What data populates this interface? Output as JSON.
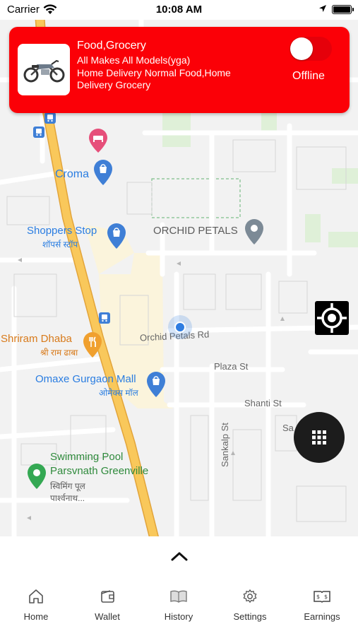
{
  "status_bar": {
    "carrier": "Carrier",
    "time": "10:08 AM"
  },
  "card": {
    "title": "Food,Grocery",
    "line1": "All Makes All Models(yga)",
    "line2": "Home Delivery Normal Food,Home",
    "line3": "Delivery Grocery",
    "status": "Offline",
    "toggle_on": false,
    "thumbnail_icon": "motorcycle-image"
  },
  "map": {
    "labels": {
      "croma": "Croma",
      "shoppers_stop": "Shoppers Stop",
      "shoppers_stop_hi": "शॉपर्स स्टॉप",
      "orchid_petals": "ORCHID PETALS",
      "orchid_petals_rd": "Orchid Petals Rd",
      "shriram_dhaba": "Shriram Dhaba",
      "shriram_dhaba_hi": "श्री राम ढाबा",
      "omaxe_mall": "Omaxe Gurgaon Mall",
      "omaxe_mall_hi": "ओमेक्स मॉल",
      "plaza_st": "Plaza St",
      "shanti_st": "Shanti St",
      "sankalp_st": "Sankalp St",
      "swimming_pool_1": "Swimming Pool",
      "swimming_pool_2": "Parsvnath Greenville",
      "swimming_pool_hi1": "स्विमिंग पूल",
      "swimming_pool_hi2": "पार्श्वनाथ..."
    },
    "colors": {
      "highway": "#f9c85b",
      "highway_edge": "#e7a83c",
      "mall_area": "#fbf4dc",
      "road": "#ffffff",
      "user_dot": "#2f7de1"
    }
  },
  "tabs": [
    {
      "label": "Home",
      "icon": "home-icon"
    },
    {
      "label": "Wallet",
      "icon": "wallet-icon"
    },
    {
      "label": "History",
      "icon": "book-icon"
    },
    {
      "label": "Settings",
      "icon": "gear-icon"
    },
    {
      "label": "Earnings",
      "icon": "earnings-icon"
    }
  ],
  "colors": {
    "card_bg": "#fb0007",
    "text_on_card": "#ffffff"
  }
}
